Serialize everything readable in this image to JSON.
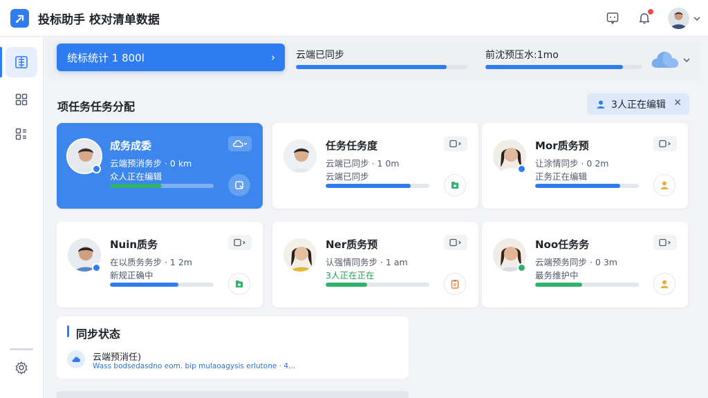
{
  "app": {
    "title": "投标助手 校对清单数据"
  },
  "topbar": {
    "icons": [
      "chat-icon",
      "bell-icon"
    ],
    "notifications": ""
  },
  "summary": {
    "stat_button_label": "统标统计 1 800l",
    "cloud_sync_label": "云端已同步",
    "cloud_sync_progress": 0.88,
    "processing_label": "前沈预压水:1mo",
    "processing_progress": 0.88
  },
  "section": {
    "title": "项任务任务分配",
    "editing_chip": "3人正在编辑"
  },
  "cards": [
    {
      "name": "成务成委",
      "line1": "云端预消务步 · 0 km",
      "line2": "众人正在编辑",
      "progress": 0.5,
      "bar_color": "#2fb36b",
      "status_color": "#2f7cf0",
      "selected": true,
      "action_icon": "document-icon",
      "menu_icon": "cloud-icon"
    },
    {
      "name": "任务任务度",
      "line1": "云端已同步 · 1 0m",
      "line2": "云端已同步",
      "progress": 0.82,
      "bar_color": "#2f7cf0",
      "status_color": "",
      "selected": false,
      "action_icon": "green-file-icon",
      "menu_icon": "square-chevron-icon"
    },
    {
      "name": "Mor质务预",
      "line1": "让涂情同步 · 0 2m",
      "line2": "正务正在编辑",
      "progress": 0.82,
      "bar_color": "#2f7cf0",
      "status_color": "#2f7cf0",
      "selected": false,
      "action_icon": "person-icon",
      "menu_icon": "square-chevron-icon"
    },
    {
      "name": "Nuin质务",
      "line1": "在以质务务步 · 1 2m",
      "line2": "新规正确中",
      "progress": 0.66,
      "bar_color": "#2f7cf0",
      "status_color": "#2f7cf0",
      "selected": false,
      "action_icon": "green-file-icon",
      "menu_icon": "square-chevron-icon"
    },
    {
      "name": "Ner质务预",
      "line1": "认强情同务步 · 1 am",
      "line2": "3人正在正在",
      "progress": 0.4,
      "bar_color": "#2fb36b",
      "status_color": "",
      "selected": false,
      "action_icon": "clipboard-icon",
      "menu_icon": "square-chevron-icon",
      "line2_green": true
    },
    {
      "name": "Noo任务务",
      "line1": "云端预务同步 · 0 3m",
      "line2": "最务维护中",
      "progress": 0.45,
      "bar_color": "#2fb36b",
      "status_color": "#2fb36b",
      "selected": false,
      "action_icon": "person-icon",
      "menu_icon": "square-chevron-icon"
    }
  ],
  "sync_panel": {
    "title": "同步状态",
    "line1": "云端预消任)",
    "line2": "Wass bodsedasdno eom. bip mulaoagysis erlutone · 4..."
  },
  "colors": {
    "primary": "#2f7cf0",
    "success": "#2fb36b",
    "danger": "#f04b4b"
  }
}
